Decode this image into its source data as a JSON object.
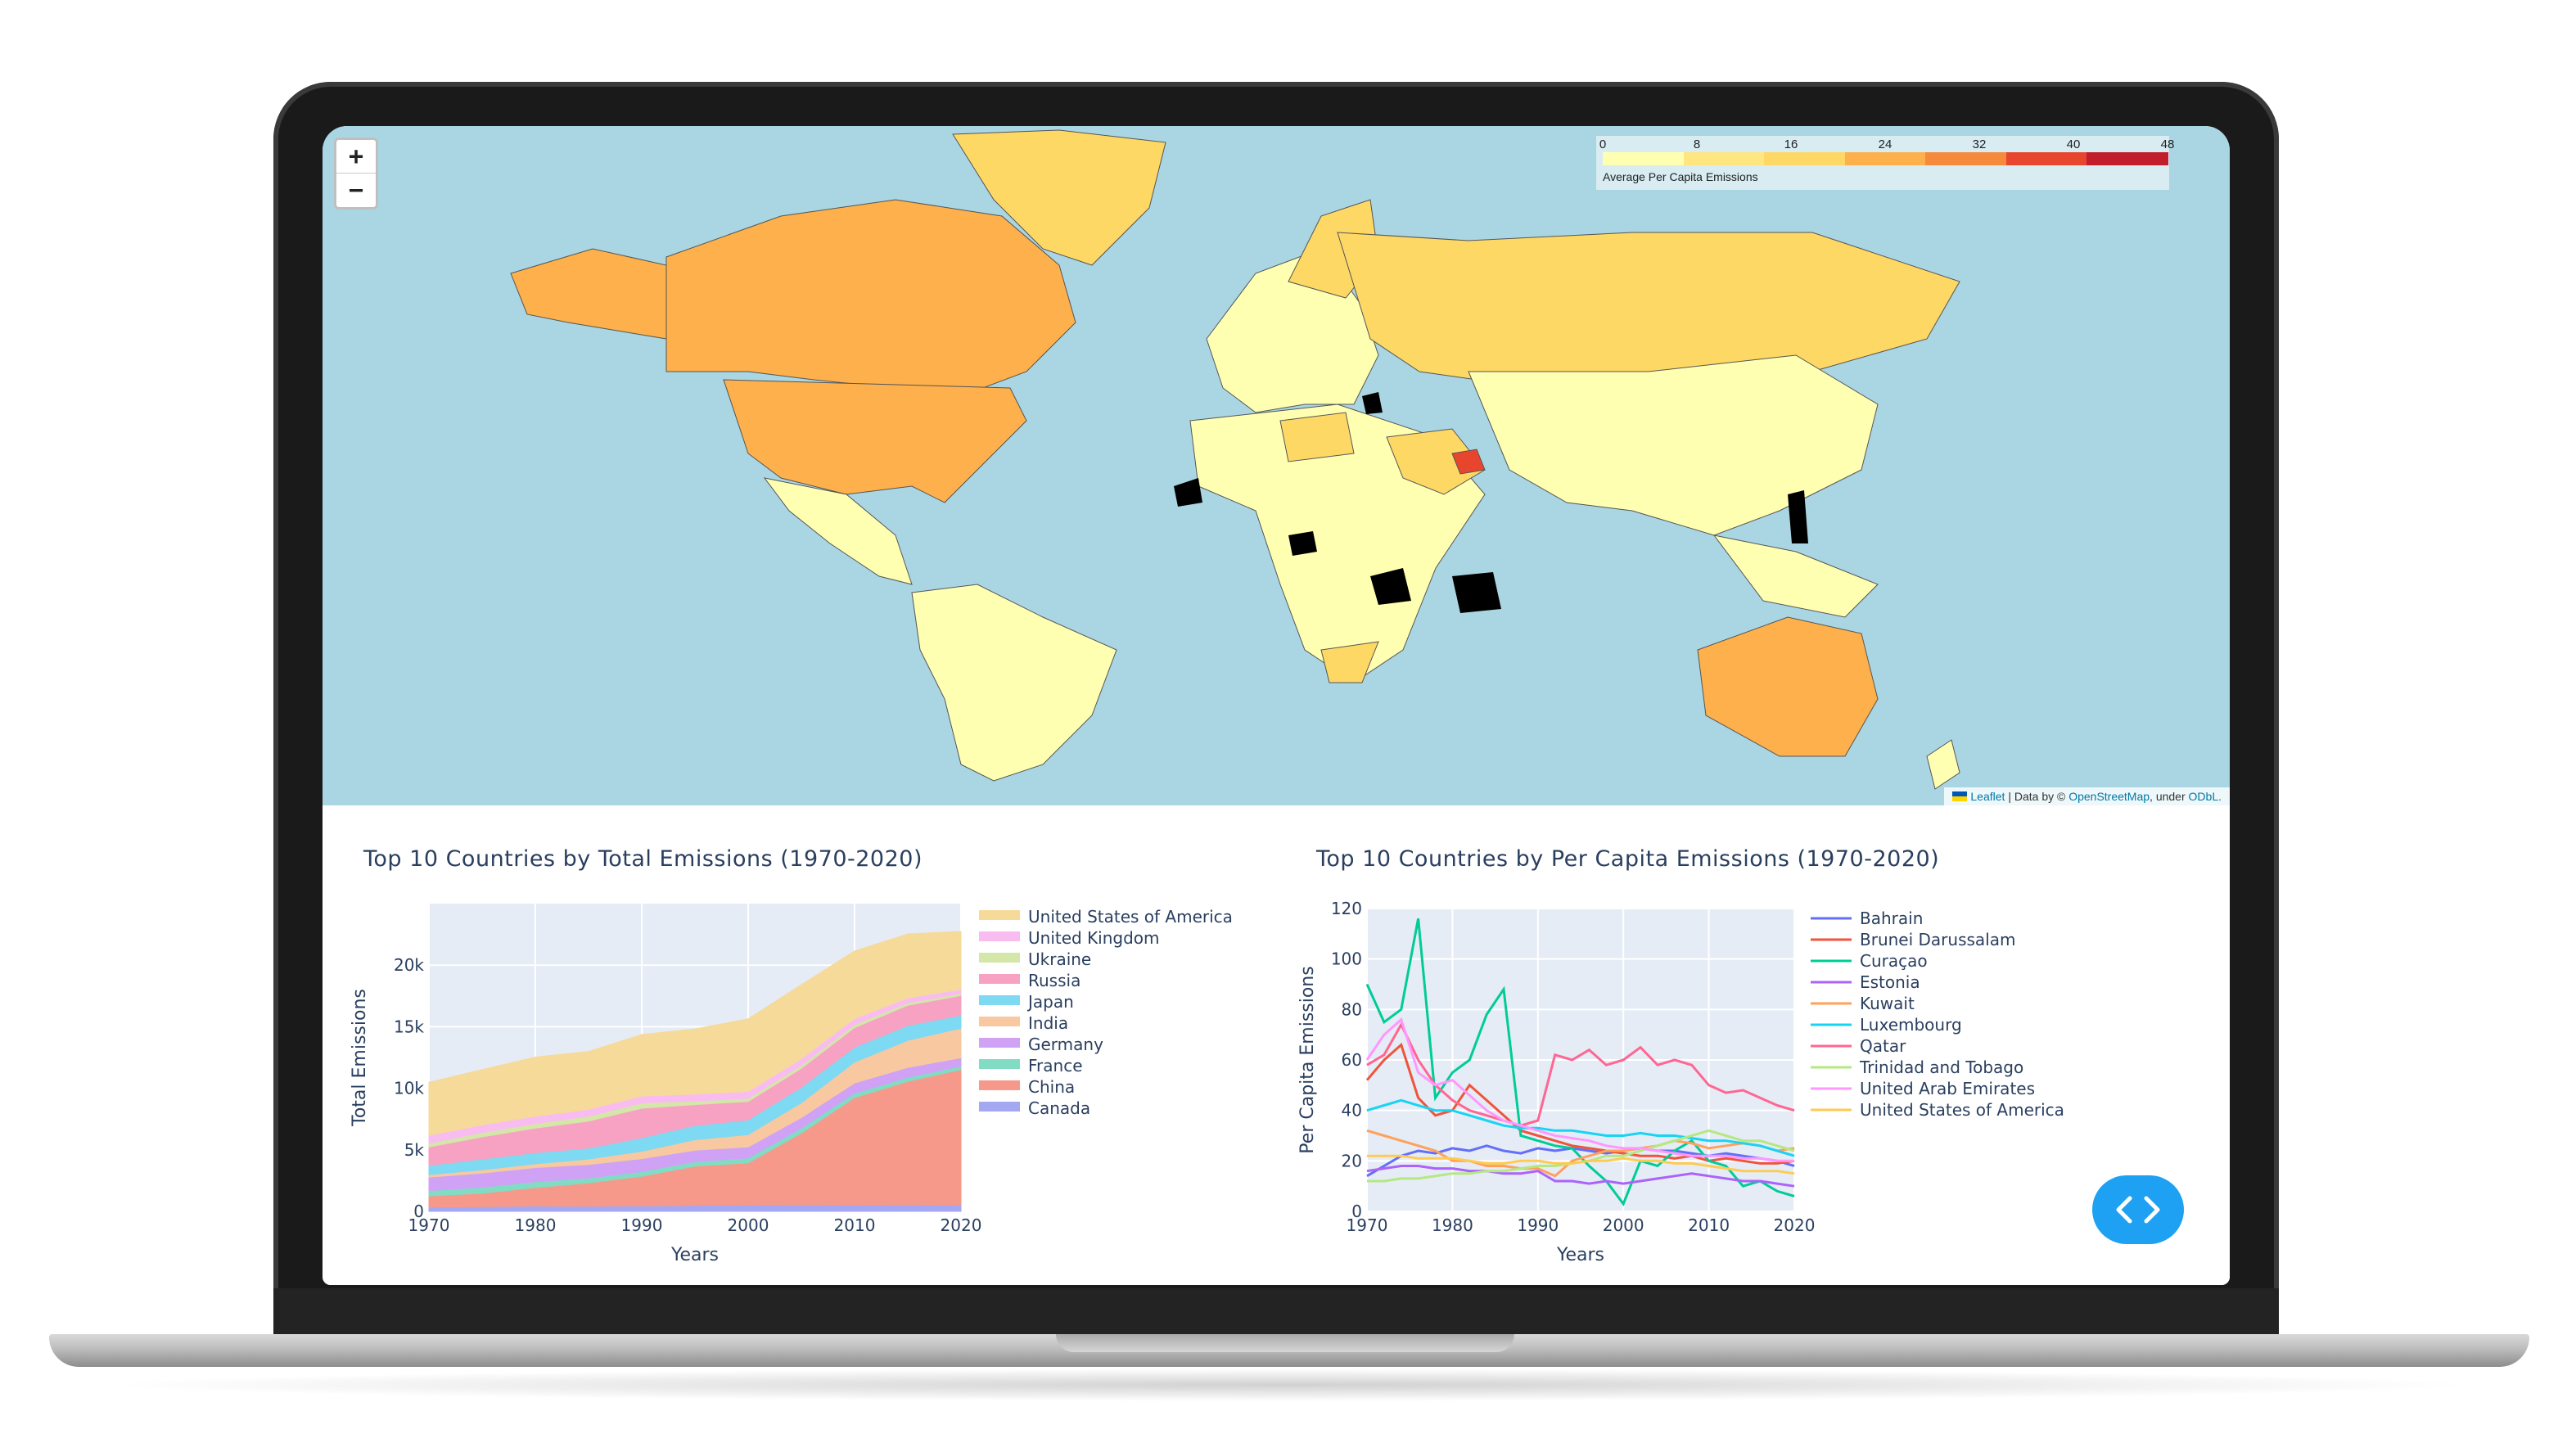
{
  "map": {
    "zoom_in_label": "+",
    "zoom_out_label": "−",
    "legend": {
      "title": "Average Per Capita Emissions",
      "ticks": [
        "0",
        "8",
        "16",
        "24",
        "32",
        "40",
        "48"
      ],
      "colors": [
        "#ffffb2",
        "#ffe680",
        "#fed865",
        "#fdb04b",
        "#f58a3c",
        "#e8452e",
        "#c21d2b"
      ]
    },
    "attribution": {
      "leaflet": "Leaflet",
      "separator": " | Data by © ",
      "osm": "OpenStreetMap",
      "under": ", under ",
      "odbl": "ODbL."
    }
  },
  "charts": {
    "total": {
      "title": "Top 10 Countries by Total Emissions (1970-2020)"
    },
    "per_capita": {
      "title": "Top 10 Countries by Per Capita Emissions (1970-2020)"
    },
    "toggle_button_icon": "code-arrows-icon"
  },
  "chart_data": [
    {
      "type": "area",
      "title": "Top 10 Countries by Total Emissions (1970-2020)",
      "xlabel": "Years",
      "ylabel": "Total Emissions",
      "x": [
        1970,
        1975,
        1980,
        1985,
        1990,
        1995,
        2000,
        2005,
        2010,
        2015,
        2020
      ],
      "xticks": [
        "1970",
        "1980",
        "1990",
        "2000",
        "2010",
        "2020"
      ],
      "yticks": [
        "0",
        "5k",
        "10k",
        "15k",
        "20k"
      ],
      "ylim": [
        0,
        25000
      ],
      "grid": true,
      "legend_position": "right",
      "series": [
        {
          "name": "Canada",
          "color": "#a4a8f2",
          "values": [
            350,
            380,
            430,
            420,
            450,
            480,
            540,
            560,
            540,
            560,
            520
          ]
        },
        {
          "name": "China",
          "color": "#f6998a",
          "values": [
            900,
            1100,
            1500,
            1900,
            2400,
            3200,
            3400,
            5800,
            8700,
            10000,
            11000
          ]
        },
        {
          "name": "France",
          "color": "#82dcc4",
          "values": [
            430,
            480,
            480,
            380,
            380,
            370,
            390,
            400,
            360,
            330,
            280
          ]
        },
        {
          "name": "Germany",
          "color": "#cfa2f5",
          "values": [
            1100,
            1150,
            1150,
            1100,
            1050,
            920,
            900,
            860,
            830,
            800,
            680
          ]
        },
        {
          "name": "India",
          "color": "#f8c9a0",
          "values": [
            200,
            260,
            300,
            450,
            600,
            850,
            1000,
            1200,
            1700,
            2200,
            2400
          ]
        },
        {
          "name": "Japan",
          "color": "#7ed9f2",
          "values": [
            750,
            880,
            900,
            880,
            1100,
            1150,
            1200,
            1250,
            1200,
            1200,
            1050
          ]
        },
        {
          "name": "Russia",
          "color": "#f7a2c2",
          "values": [
            1500,
            1800,
            2000,
            2200,
            2400,
            1700,
            1500,
            1550,
            1600,
            1650,
            1600
          ]
        },
        {
          "name": "Ukraine",
          "color": "#d4e6a8",
          "values": [
            300,
            350,
            380,
            400,
            420,
            300,
            250,
            250,
            250,
            200,
            180
          ]
        },
        {
          "name": "United Kingdom",
          "color": "#f9bcf0",
          "values": [
            650,
            620,
            590,
            560,
            570,
            550,
            560,
            540,
            480,
            400,
            330
          ]
        },
        {
          "name": "United States of America",
          "color": "#f6da9a",
          "values": [
            4300,
            4500,
            4800,
            4700,
            5000,
            5300,
            5900,
            6000,
            5500,
            5200,
            4700
          ]
        }
      ]
    },
    {
      "type": "line",
      "title": "Top 10 Countries by Per Capita Emissions (1970-2020)",
      "xlabel": "Years",
      "ylabel": "Per Capita Emissions",
      "x": [
        1970,
        1972,
        1974,
        1976,
        1978,
        1980,
        1982,
        1984,
        1986,
        1988,
        1990,
        1992,
        1994,
        1996,
        1998,
        2000,
        2002,
        2004,
        2006,
        2008,
        2010,
        2012,
        2014,
        2016,
        2018,
        2020
      ],
      "xticks": [
        "1970",
        "1980",
        "1990",
        "2000",
        "2010",
        "2020"
      ],
      "yticks": [
        "0",
        "20",
        "40",
        "60",
        "80",
        "100",
        "120"
      ],
      "ylim": [
        0,
        120
      ],
      "grid": true,
      "legend_position": "right",
      "series": [
        {
          "name": "Bahrain",
          "color": "#636efa",
          "values": [
            14,
            18,
            22,
            24,
            23,
            25,
            24,
            26,
            24,
            23,
            25,
            24,
            25,
            24,
            23,
            24,
            25,
            24,
            24,
            23,
            22,
            23,
            22,
            21,
            20,
            18
          ]
        },
        {
          "name": "Brunei Darussalam",
          "color": "#ef553b",
          "values": [
            52,
            60,
            66,
            45,
            38,
            40,
            50,
            44,
            38,
            32,
            30,
            28,
            26,
            25,
            24,
            23,
            22,
            22,
            21,
            22,
            20,
            21,
            20,
            19,
            19,
            20
          ]
        },
        {
          "name": "Curaçao",
          "color": "#00cc96",
          "values": [
            90,
            75,
            80,
            116,
            45,
            55,
            60,
            78,
            88,
            30,
            28,
            26,
            25,
            18,
            12,
            3,
            20,
            18,
            24,
            28,
            20,
            18,
            10,
            12,
            8,
            6
          ]
        },
        {
          "name": "Estonia",
          "color": "#ab63fa",
          "values": [
            16,
            17,
            18,
            18,
            17,
            17,
            16,
            16,
            15,
            15,
            16,
            12,
            12,
            11,
            12,
            11,
            12,
            13,
            14,
            15,
            14,
            13,
            12,
            12,
            11,
            10
          ]
        },
        {
          "name": "Kuwait",
          "color": "#ffa15a",
          "values": [
            32,
            30,
            28,
            26,
            24,
            20,
            20,
            18,
            18,
            17,
            17,
            14,
            20,
            22,
            24,
            24,
            25,
            26,
            28,
            27,
            25,
            26,
            27,
            26,
            24,
            25
          ]
        },
        {
          "name": "Luxembourg",
          "color": "#19d3f3",
          "values": [
            40,
            42,
            44,
            42,
            40,
            40,
            38,
            36,
            34,
            33,
            33,
            32,
            32,
            31,
            30,
            30,
            31,
            30,
            30,
            29,
            28,
            28,
            27,
            26,
            24,
            22
          ]
        },
        {
          "name": "Qatar",
          "color": "#ff6692",
          "values": [
            58,
            62,
            74,
            60,
            50,
            44,
            40,
            38,
            36,
            34,
            36,
            62,
            60,
            64,
            58,
            60,
            65,
            58,
            60,
            58,
            50,
            47,
            48,
            45,
            42,
            40
          ]
        },
        {
          "name": "Trinidad and Tobago",
          "color": "#b6e880",
          "values": [
            12,
            12,
            13,
            13,
            14,
            15,
            15,
            16,
            16,
            17,
            18,
            18,
            19,
            20,
            22,
            22,
            24,
            26,
            28,
            30,
            32,
            30,
            28,
            28,
            26,
            24
          ]
        },
        {
          "name": "United Arab Emirates",
          "color": "#ff97ff",
          "values": [
            60,
            70,
            76,
            55,
            50,
            52,
            46,
            40,
            36,
            34,
            32,
            30,
            29,
            28,
            26,
            25,
            25,
            24,
            23,
            22,
            22,
            22,
            21,
            21,
            20,
            20
          ]
        },
        {
          "name": "United States of America",
          "color": "#fecb52",
          "values": [
            22,
            22,
            22,
            21,
            21,
            21,
            20,
            19,
            19,
            20,
            20,
            19,
            19,
            20,
            20,
            21,
            20,
            20,
            19,
            19,
            18,
            17,
            16,
            16,
            16,
            15
          ]
        }
      ]
    }
  ]
}
